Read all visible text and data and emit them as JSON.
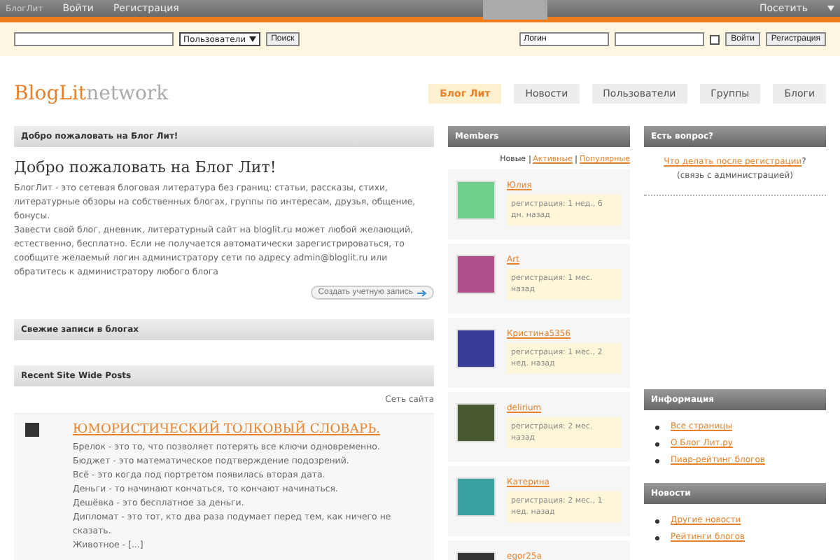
{
  "topbar": {
    "site": "БлогЛит",
    "links": [
      "Войти",
      "Регистрация"
    ],
    "visit": "Посетить"
  },
  "searchbar": {
    "select": "Пользователи",
    "search_button": "Поиск",
    "login_value": "Логин",
    "remember_checked": false,
    "login_button": "Войти",
    "register_button": "Регистрация"
  },
  "logo": {
    "brand": "BlogLit",
    "suffix": "network"
  },
  "nav": [
    {
      "label": "Блог Лит",
      "selected": true
    },
    {
      "label": "Новости",
      "selected": false
    },
    {
      "label": "Пользователи",
      "selected": false
    },
    {
      "label": "Группы",
      "selected": false
    },
    {
      "label": "Блоги",
      "selected": false
    }
  ],
  "welcome": {
    "header": "Добро пожаловать на Блог Лит!",
    "title": "Добро пожаловать на Блог Лит!",
    "paragraphs": [
      "БлогЛит - это сетевая блоговая литература без границ: статьи, рассказы, стихи, литературные обзоры на собственных блогах, группы по интересам, друзья, общение, бонусы.",
      "Завести свой блог, дневник, литературный сайт на bloglit.ru может любой желающий, естественно, бесплатно. Если не получается автоматически зарегистрироваться, то сообщите желаемый логин администратору сети по адресу admin@bloglit.ru или обратитесь к администратору любого блога"
    ],
    "button": "Создать учетную запись"
  },
  "fresh": {
    "header": "Свежие записи в блогах"
  },
  "recent": {
    "header": "Recent Site Wide Posts",
    "network_link": "Сеть сайта",
    "post_title": "ЮМОРИСТИЧЕСКИЙ ТОЛКОВЫЙ СЛОВАРЬ.",
    "lines": [
      "Брелок - это то, что позволяет потерять все ключи одновременно.",
      "Бюджет - это математическое подтверждение подозрений.",
      "Всё - это когда под портретом появилась вторая дата.",
      "Деньги - то начинают кончаться, то кончают начинаться.",
      "Дешёвка - это бесплатное за деньги.",
      "Дипломат - это тот, кто два раза подумает перед тем, как ничего не сказать.",
      "Животное - [...]"
    ]
  },
  "members": {
    "header": "Members",
    "filters": [
      {
        "label": "Новые",
        "selected": true
      },
      {
        "label": "Активные",
        "selected": false
      },
      {
        "label": "Популярные",
        "selected": false
      }
    ],
    "items": [
      {
        "name": "Юлия",
        "registered": "регистрация: 1 нед., 6 дн. назад",
        "color": "#6fcf8a"
      },
      {
        "name": "Art",
        "registered": "регистрация: 1 мес. назад",
        "color": "#b0508a"
      },
      {
        "name": "Кристина5356",
        "registered": "регистрация: 1 мес., 2 нед. назад",
        "color": "#3a3a9a"
      },
      {
        "name": "delirium",
        "registered": "регистрация: 2 мес. назад",
        "color": "#4a5a30"
      },
      {
        "name": "Катерина",
        "registered": "регистрация: 2 мес., 1 нед. назад",
        "color": "#3aa0a0"
      },
      {
        "name": "egor25a",
        "color": "#333333"
      }
    ]
  },
  "question": {
    "header": "Есть вопрос?",
    "link": "Что делать после регистрации",
    "tail": "?",
    "note": "(связь с администрацией)"
  },
  "info": {
    "header": "Информация",
    "links": [
      "Все страницы",
      "О Блог Лит.ру",
      "Пиар-рейтинг блогов"
    ]
  },
  "news": {
    "header": "Новости",
    "links": [
      "Другие новости",
      "Рейтинги блогов"
    ]
  }
}
